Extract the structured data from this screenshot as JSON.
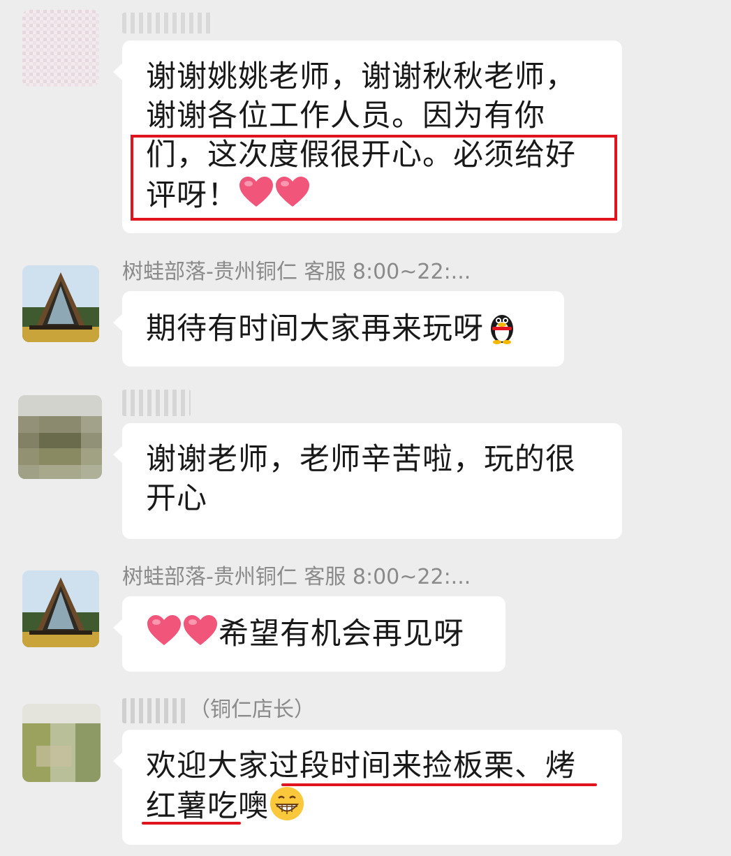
{
  "messages": [
    {
      "sender": "",
      "text_lines": [
        "谢谢姚姚老师，谢谢秋秋老师，",
        "谢谢各位工作人员。因为有你",
        "们，这次度假很开心。必须给好",
        "评呀！"
      ],
      "emoji": "red-heart-icon ×2"
    },
    {
      "sender": "树蛙部落-贵州铜仁 客服 8:00~22:...",
      "text": "期待有时间大家再来玩呀",
      "emoji": "qq-penguin-icon"
    },
    {
      "sender": "",
      "text_lines": [
        "谢谢老师，老师辛苦啦，玩的很",
        "开心"
      ]
    },
    {
      "sender": "树蛙部落-贵州铜仁 客服 8:00~22:...",
      "text": "希望有机会再见呀",
      "emoji": "red-heart-icon ×2"
    },
    {
      "sender_suffix": "（铜仁店长）",
      "text_lines": [
        "欢迎大家过段时间来捡板栗、烤",
        "红薯吃噢"
      ],
      "emoji": "grinning-face-icon"
    }
  ],
  "colors": {
    "background": "#ededed",
    "bubble": "#ffffff",
    "highlight": "#e0131e",
    "sender_name": "#8a8a8a"
  }
}
